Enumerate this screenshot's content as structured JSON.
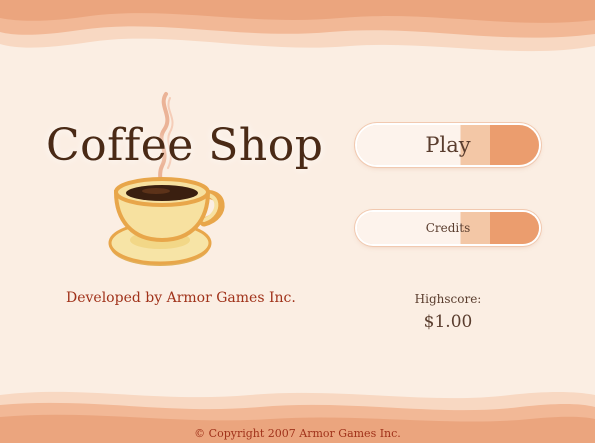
{
  "game": {
    "title": "Coffee Shop",
    "developer": "Developed by Armor Games Inc.",
    "copyright": "© Copyright 2007 Armor Games Inc."
  },
  "menu": {
    "play_label": "Play",
    "credits_label": "Credits"
  },
  "highscore": {
    "label": "Highscore:",
    "value": "$1.00"
  },
  "colors": {
    "background": "#fbeee3",
    "wave_dark": "#eba57e",
    "wave_light": "#f6c9ad",
    "title_text": "#4a2a16",
    "accent_text": "#a0321a",
    "button_fill": "#eb9d6e",
    "cup_fill": "#f7e1a0",
    "cup_outline": "#e8a64a"
  },
  "icons": {
    "logo": "coffee-cup-icon"
  }
}
